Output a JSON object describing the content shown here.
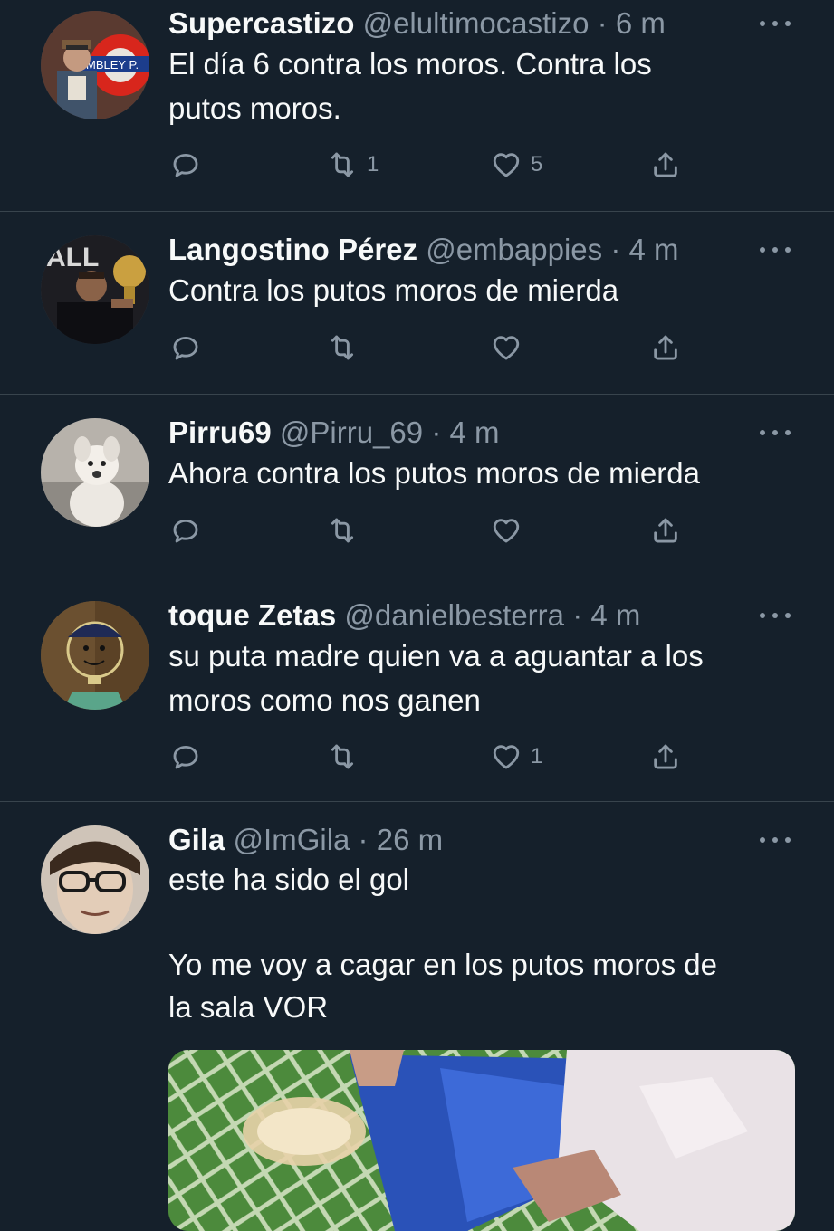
{
  "tweets": [
    {
      "name": "Supercastizo",
      "handle": "@elultimocastizo",
      "time": "6 m",
      "text_lines": [
        "El día 6 contra los moros. Contra los",
        "putos moros."
      ],
      "reply_count": "",
      "retweet_count": "1",
      "like_count": "5",
      "avatar_sign_text": "MBLEY P."
    },
    {
      "name": "Langostino Pérez",
      "handle": "@embappies",
      "time": "4 m",
      "text_lines": [
        "Contra los putos moros de mierda"
      ],
      "reply_count": "",
      "retweet_count": "",
      "like_count": ""
    },
    {
      "name": "Pirru69",
      "handle": "@Pirru_69",
      "time": "4 m",
      "text_lines": [
        "Ahora contra los putos moros de mierda"
      ],
      "reply_count": "",
      "retweet_count": "",
      "like_count": ""
    },
    {
      "name": "toque Zetas",
      "handle": "@danielbesterra",
      "time": "4 m",
      "text_lines": [
        "su puta madre quien va a aguantar a los",
        "moros como nos ganen"
      ],
      "reply_count": "",
      "retweet_count": "",
      "like_count": "1"
    },
    {
      "name": "Gila",
      "handle": "@ImGila",
      "time": "26 m",
      "text_lines": [
        "este ha sido el gol",
        "",
        "Yo me voy a cagar en los putos moros de",
        "la sala VOR"
      ]
    }
  ],
  "separator": "·",
  "colors": {
    "background": "#15202b",
    "text": "#f7f9f9",
    "secondary": "#8b98a5",
    "divider": "#38444d"
  },
  "icons": {
    "reply": "reply-icon",
    "retweet": "retweet-icon",
    "like": "heart-icon",
    "share": "share-icon",
    "more": "more-icon"
  }
}
